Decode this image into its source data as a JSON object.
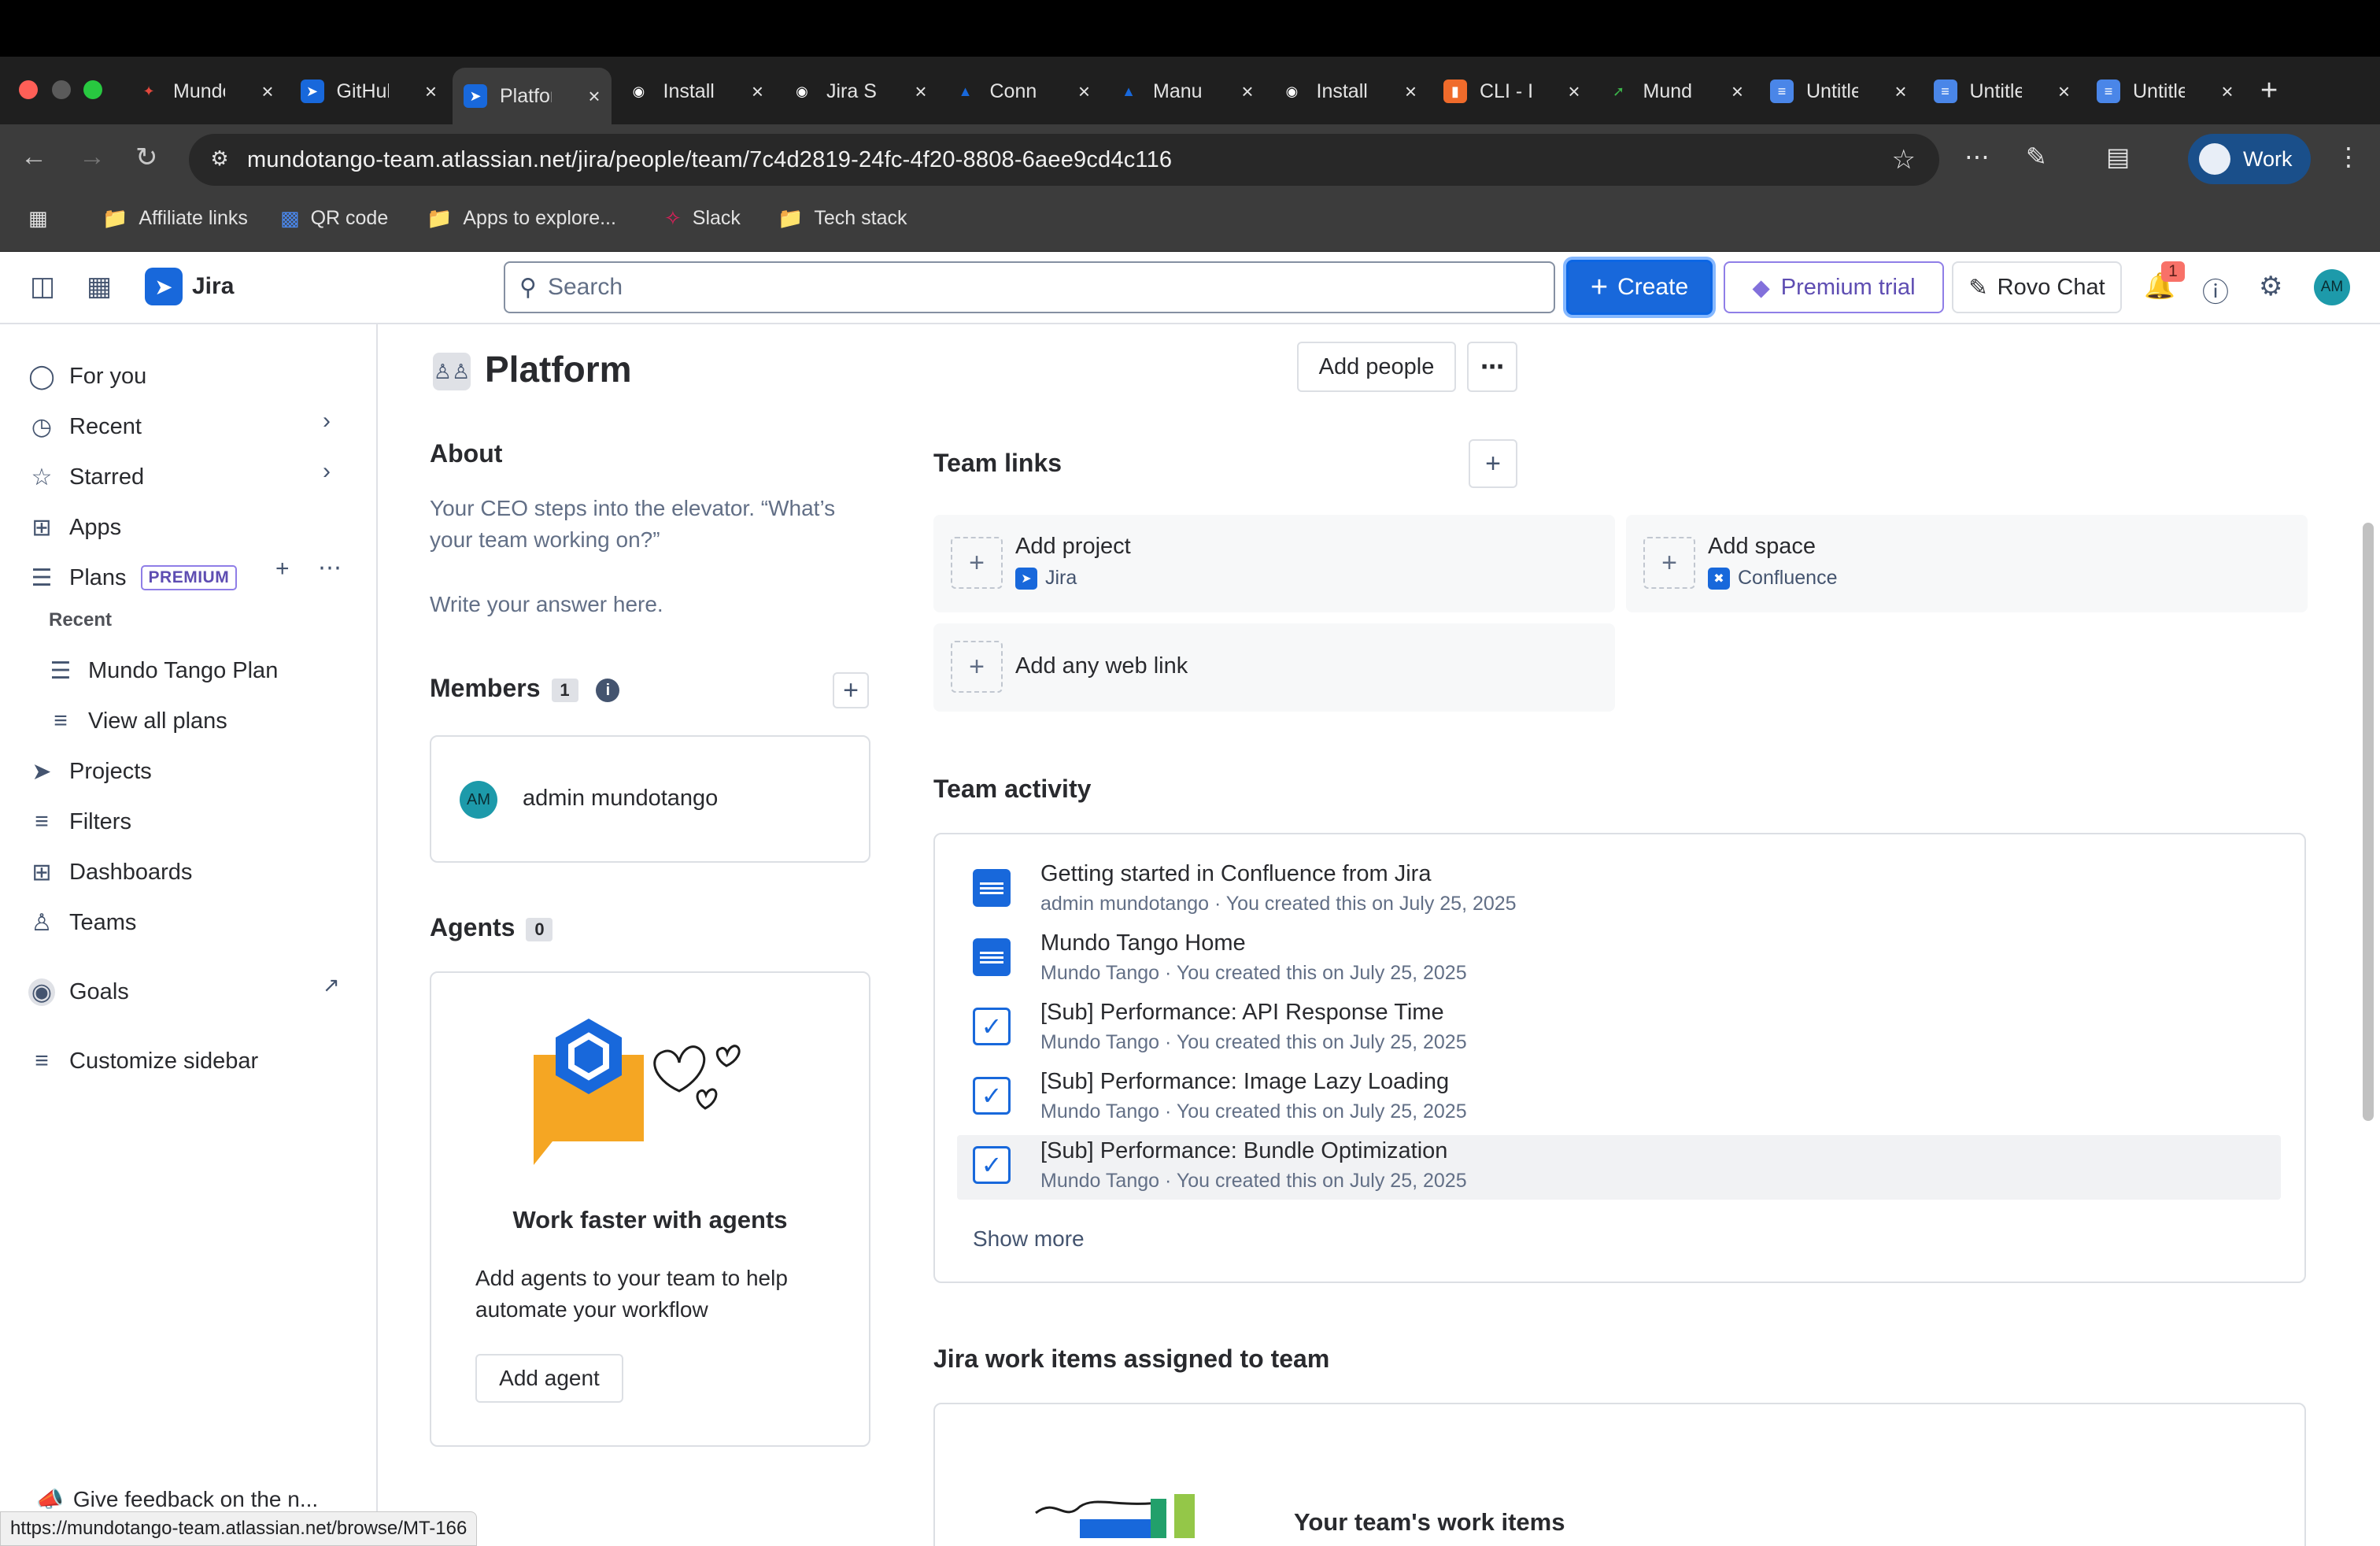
{
  "browser": {
    "tabs": [
      {
        "label": "Mundo",
        "icon": "jira-dots-icon",
        "color": "#e2483d"
      },
      {
        "label": "GitHub",
        "icon": "jira-icon",
        "color": "#1868db"
      },
      {
        "label": "Platform",
        "icon": "jira-icon",
        "color": "#1868db"
      },
      {
        "label": "Install",
        "icon": "github-icon",
        "color": "#ffffff"
      },
      {
        "label": "Jira S",
        "icon": "github-icon",
        "color": "#ffffff"
      },
      {
        "label": "Conn",
        "icon": "atlassian-icon",
        "color": "#1868db"
      },
      {
        "label": "Manu",
        "icon": "atlassian-icon",
        "color": "#1868db"
      },
      {
        "label": "Install",
        "icon": "github-icon",
        "color": "#ffffff"
      },
      {
        "label": "CLI - I",
        "icon": "cli-icon",
        "color": "#f06b2b"
      },
      {
        "label": "Mund",
        "icon": "bolt-icon",
        "color": "#3bb54a"
      },
      {
        "label": "Untitle",
        "icon": "docs-icon",
        "color": "#4a86e8"
      },
      {
        "label": "Untitle",
        "icon": "docs-icon",
        "color": "#4a86e8"
      },
      {
        "label": "Untitle",
        "icon": "docs-icon",
        "color": "#4a86e8"
      }
    ],
    "url": "mundotango-team.atlassian.net/jira/people/team/7c4d2819-24fc-4f20-8808-6aee9cd4c116",
    "profile_label": "Work",
    "bookmarks": [
      {
        "label": "Affiliate links",
        "icon": "folder-icon"
      },
      {
        "label": "QR code",
        "icon": "qr-icon"
      },
      {
        "label": "Apps to explore...",
        "icon": "folder-icon"
      },
      {
        "label": "Slack",
        "icon": "slack-icon"
      },
      {
        "label": "Tech stack",
        "icon": "folder-icon"
      }
    ],
    "status_url": "https://mundotango-team.atlassian.net/browse/MT-166"
  },
  "jira_nav": {
    "product_name": "Jira",
    "search_placeholder": "Search",
    "create_label": "Create",
    "premium_label": "Premium trial",
    "rovo_label": "Rovo Chat",
    "notification_count": "1",
    "avatar_initials": "AM"
  },
  "sidebar": {
    "items": [
      {
        "label": "For you",
        "icon": "person-circle-icon"
      },
      {
        "label": "Recent",
        "icon": "clock-icon"
      },
      {
        "label": "Starred",
        "icon": "star-icon"
      },
      {
        "label": "Apps",
        "icon": "apps-icon"
      },
      {
        "label": "Plans",
        "icon": "plans-icon"
      },
      {
        "label": "Projects",
        "icon": "rocket-icon"
      },
      {
        "label": "Filters",
        "icon": "filter-icon"
      },
      {
        "label": "Dashboards",
        "icon": "dashboard-icon"
      },
      {
        "label": "Teams",
        "icon": "people-icon"
      },
      {
        "label": "Goals",
        "icon": "goal-icon"
      },
      {
        "label": "Customize sidebar",
        "icon": "sliders-icon"
      }
    ],
    "premium_badge": "PREMIUM",
    "plans_recent_heading": "Recent",
    "plans_sub": [
      {
        "label": "Mundo Tango Plan"
      },
      {
        "label": "View all plans"
      }
    ],
    "feedback_label": "Give feedback on the n..."
  },
  "team": {
    "name": "Platform",
    "add_people_label": "Add people",
    "about_heading": "About",
    "about_prompt": "Your CEO steps into the elevator. “What’s your team working on?”",
    "about_placeholder": "Write your answer here.",
    "members_heading": "Members",
    "members_count": "1",
    "members": [
      {
        "initials": "AM",
        "name": "admin mundotango"
      }
    ],
    "agents_heading": "Agents",
    "agents_count": "0",
    "agents_card_title": "Work faster with agents",
    "agents_card_body": "Add agents to your team to help automate your workflow",
    "add_agent_label": "Add agent"
  },
  "team_links": {
    "heading": "Team links",
    "items": [
      {
        "title": "Add project",
        "product": "Jira"
      },
      {
        "title": "Add space",
        "product": "Confluence"
      }
    ],
    "web_link_label": "Add any web link"
  },
  "team_activity": {
    "heading": "Team activity",
    "items": [
      {
        "title": "Getting started in Confluence from Jira",
        "meta": "admin mundotango · You created this on July 25, 2025",
        "kind": "doc"
      },
      {
        "title": "Mundo Tango Home",
        "meta": "Mundo Tango · You created this on July 25, 2025",
        "kind": "doc"
      },
      {
        "title": "[Sub] Performance: API Response Time",
        "meta": "Mundo Tango · You created this on July 25, 2025",
        "kind": "task"
      },
      {
        "title": "[Sub] Performance: Image Lazy Loading",
        "meta": "Mundo Tango · You created this on July 25, 2025",
        "kind": "task"
      },
      {
        "title": "[Sub] Performance: Bundle Optimization",
        "meta": "Mundo Tango · You created this on July 25, 2025",
        "kind": "task"
      }
    ],
    "show_more_label": "Show more"
  },
  "work_items": {
    "heading": "Jira work items assigned to team",
    "card_title": "Your team's work items"
  },
  "colors": {
    "brand_blue": "#1868db",
    "premium_purple": "#5e4db2",
    "agent_orange": "#f5a623"
  }
}
